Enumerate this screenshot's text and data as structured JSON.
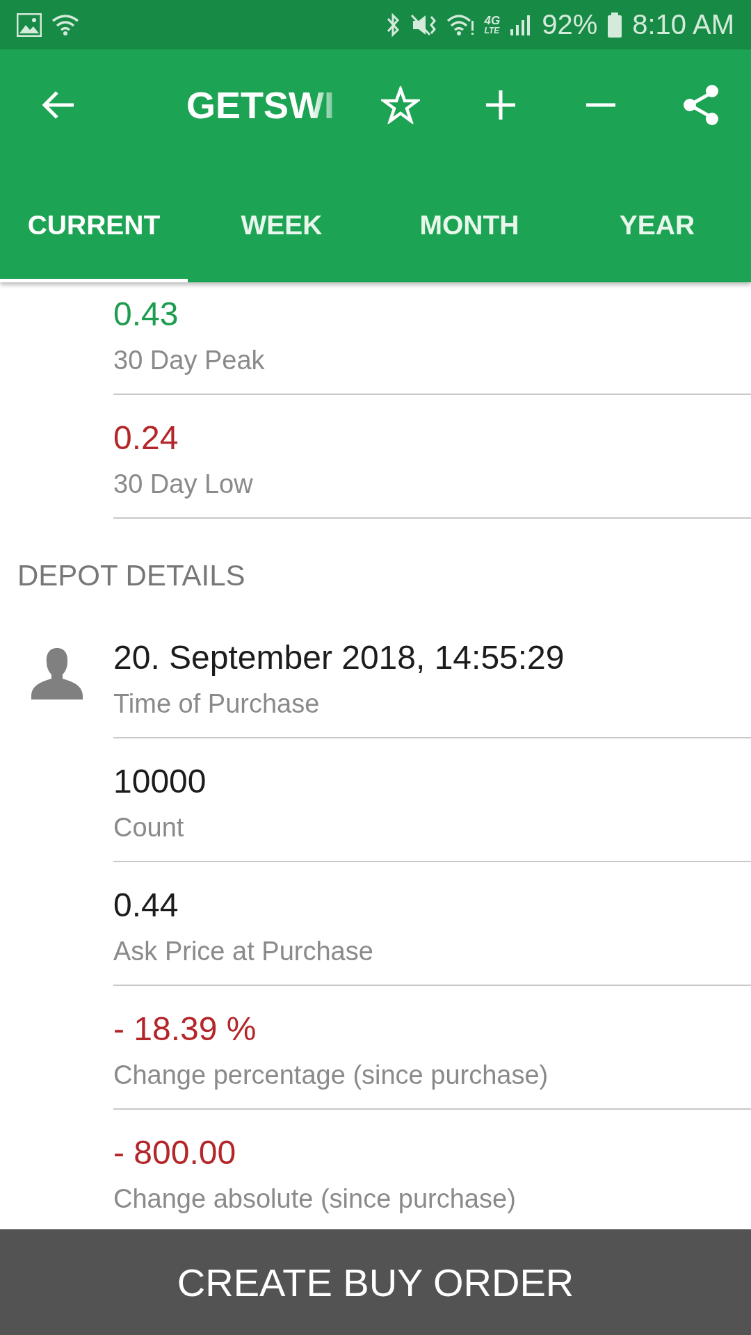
{
  "status_bar": {
    "network": "4G",
    "network_sub": "LTE",
    "battery": "92%",
    "time": "8:10 AM"
  },
  "toolbar": {
    "title": "GETSWI"
  },
  "tabs": [
    {
      "label": "CURRENT",
      "selected": true
    },
    {
      "label": "WEEK",
      "selected": false
    },
    {
      "label": "MONTH",
      "selected": false
    },
    {
      "label": "YEAR",
      "selected": false
    }
  ],
  "rows": [
    {
      "value": "0.43",
      "label": "30 Day Peak",
      "color": "#1e9c4f"
    },
    {
      "value": "0.24",
      "label": "30 Day Low",
      "color": "#b3262a"
    }
  ],
  "depot": {
    "heading": "DEPOT DETAILS",
    "rows": [
      {
        "value": "20. September 2018, 14:55:29",
        "label": "Time of Purchase",
        "color": "#1c1c1c",
        "avatar": true
      },
      {
        "value": "10000",
        "label": "Count",
        "color": "#1c1c1c",
        "avatar": false
      },
      {
        "value": "0.44",
        "label": "Ask Price at Purchase",
        "color": "#1c1c1c",
        "avatar": false
      },
      {
        "value": "- 18.39 %",
        "label": "Change percentage (since purchase)",
        "color": "#b3262a",
        "avatar": false
      },
      {
        "value": "- 800.00",
        "label": "Change absolute (since purchase)",
        "color": "#b3262a",
        "avatar": false
      }
    ]
  },
  "button": {
    "label": "CREATE BUY ORDER"
  }
}
